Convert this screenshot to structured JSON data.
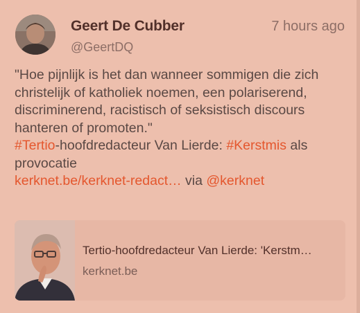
{
  "post": {
    "author_name": "Geert De Cubber",
    "author_handle": "@GeertDQ",
    "timestamp": "7 hours ago",
    "quote_lines": [
      "\"Hoe pijnlijk is het dan wanneer sommigen die zich",
      "christelijk of katholiek noemen, een polariserend,",
      "discriminerend, racistisch of seksistisch discours",
      "hanteren of promoten.\""
    ],
    "hashtag_tertio": "#Tertio",
    "text_headline_mid": "-hoofdredacteur Van Lierde: ",
    "hashtag_kerstmis": "#Kerstmis",
    "text_als": " als",
    "text_provocatie": "provocatie",
    "link_url": "kerknet.be/kerknet-redact…",
    "text_via": " via ",
    "mention": "@kerknet"
  },
  "card": {
    "title": "Tertio-hoofdredacteur Van Lierde: 'Kerstm…",
    "domain": "kerknet.be"
  },
  "colors": {
    "background": "#edbfad",
    "link": "#e4572e",
    "card_background": "#e7b7a5"
  }
}
